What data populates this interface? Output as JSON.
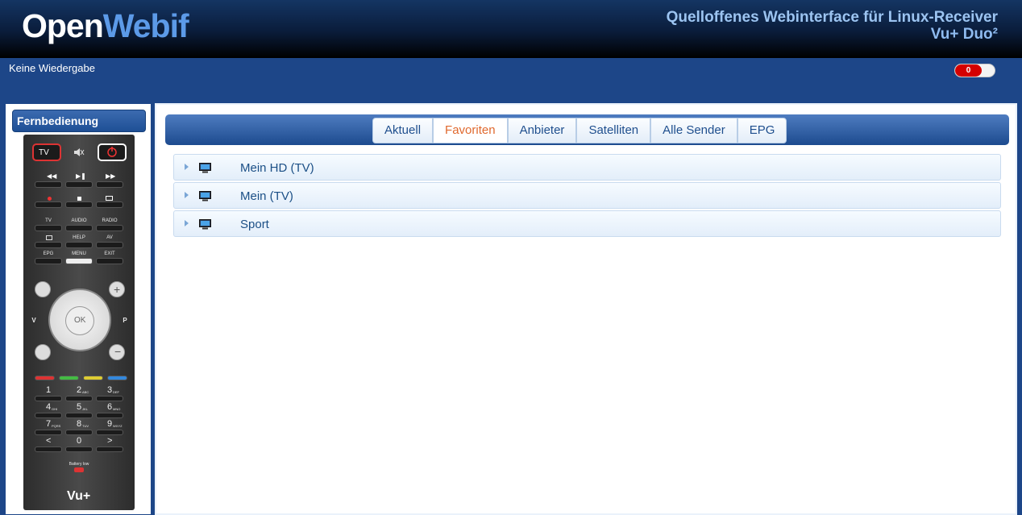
{
  "header": {
    "logo_part1": "Open",
    "logo_part2": "Webif",
    "tagline": "Quelloffenes Webinterface für Linux-Receiver",
    "model": "Vu+ Duo²"
  },
  "status": {
    "now_playing": "Keine Wiedergabe",
    "toggle_value": "0"
  },
  "colors": {
    "accent": "#1d4688",
    "active_tab": "#e0692e",
    "toggle_on": "#d40000"
  },
  "remote": {
    "title": "Fernbedienung",
    "labels": {
      "tv": "TV",
      "audio": "AUDIO",
      "radio": "RADIO",
      "help": "HELP",
      "av": "AV",
      "epg": "EPG",
      "menu": "MENU",
      "exit": "EXIT",
      "ok": "OK",
      "v": "V",
      "p": "P",
      "battery": "Battery low",
      "brand": "Vu+"
    },
    "numbers": [
      "1",
      "2",
      "3",
      "4",
      "5",
      "6",
      "7",
      "8",
      "9",
      "<",
      "0",
      ">"
    ],
    "subletters": [
      "",
      "ABC",
      "DEF",
      "GHI",
      "JKL",
      "MNO",
      "PQRS",
      "TUV",
      "WXYZ",
      "",
      "",
      ""
    ]
  },
  "tabs": [
    "Aktuell",
    "Favoriten",
    "Anbieter",
    "Satelliten",
    "Alle Sender",
    "EPG"
  ],
  "active_tab": "Favoriten",
  "bouquets": [
    "Mein HD (TV)",
    "Mein (TV)",
    "Sport"
  ]
}
